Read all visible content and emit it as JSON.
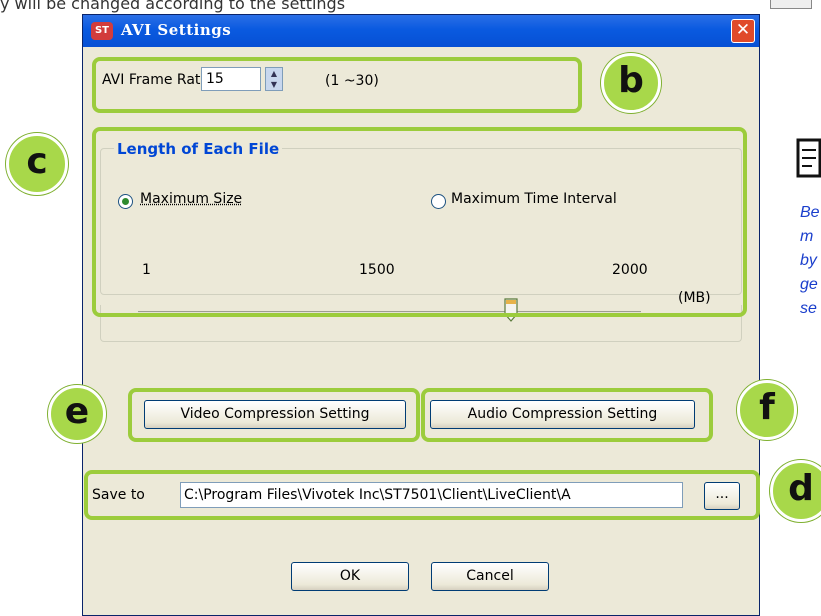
{
  "top_caption": "y will be changed according to the settings",
  "window": {
    "title": "AVI Settings",
    "app_icon": "ST",
    "close_icon": "close-icon"
  },
  "frame_rate": {
    "label": "AVI Frame Rate:",
    "value": "15",
    "range": "(1 ~30)"
  },
  "length_group": {
    "title": "Length of Each File",
    "option_size": "Maximum Size",
    "option_time": "Maximum Time Interval",
    "selected": "Maximum Size",
    "scale_min": "1",
    "scale_mid": "1500",
    "scale_max": "2000",
    "unit": "(MB)",
    "slider_value": 1500
  },
  "buttons": {
    "video": "Video Compression Setting",
    "audio": "Audio Compression Setting",
    "browse": "...",
    "ok": "OK",
    "cancel": "Cancel"
  },
  "save": {
    "label": "Save to",
    "path": "C:\\Program Files\\Vivotek Inc\\ST7501\\Client\\LiveClient\\A"
  },
  "callouts": {
    "b": "b",
    "c": "c",
    "d": "d",
    "e": "e",
    "f": "f"
  },
  "side_note": [
    "Be",
    "m",
    "by",
    "ge",
    "se"
  ],
  "colors": {
    "callout_green": "#9ccc3c",
    "title_blue": "#0a5ae0",
    "group_title": "#0046d5",
    "side_note": "#1a3ecc"
  }
}
